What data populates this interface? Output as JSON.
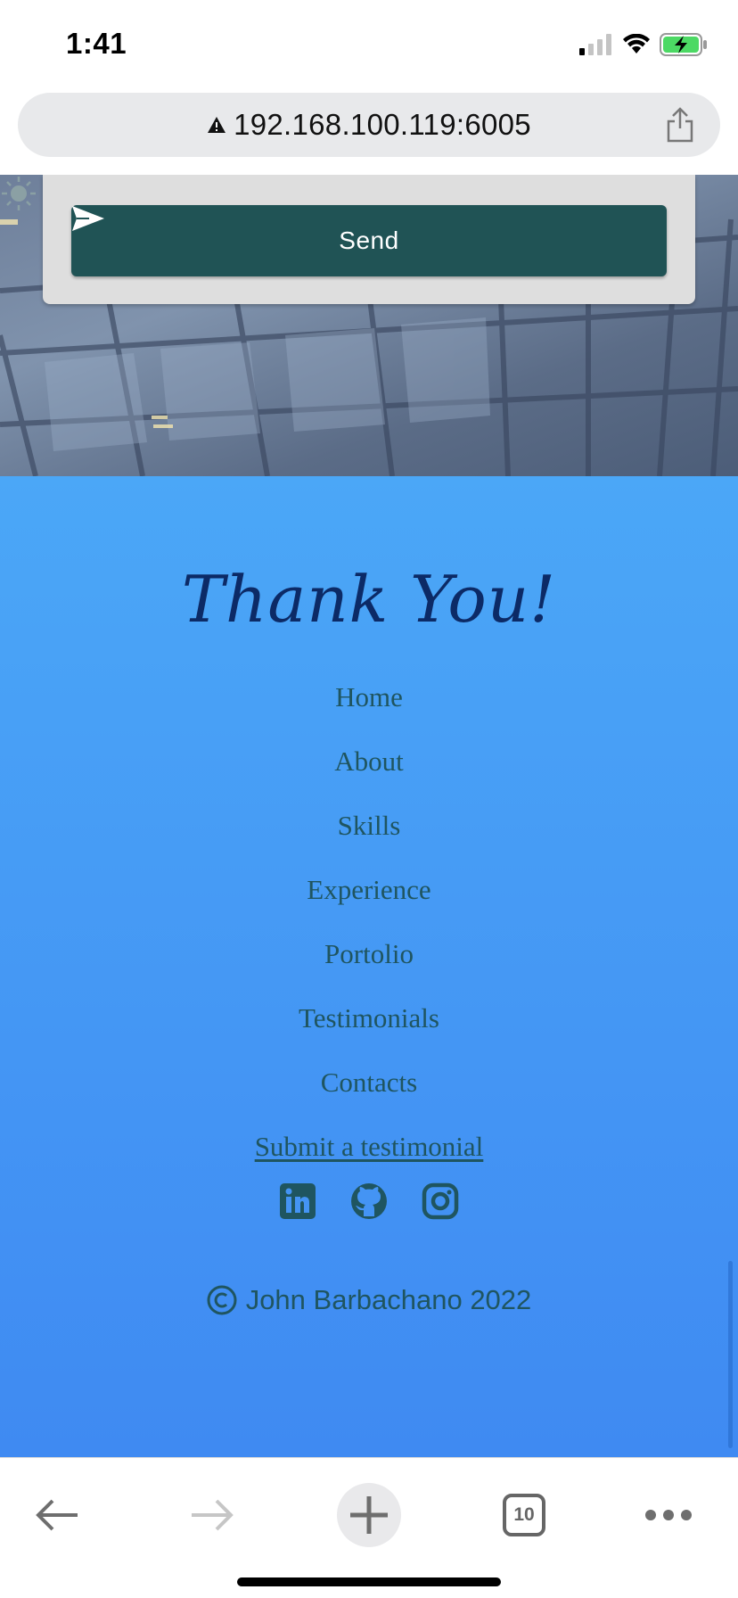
{
  "status_bar": {
    "time": "1:41",
    "signal_icon": "cellular-signal-icon",
    "wifi_icon": "wifi-icon",
    "battery_icon": "battery-charging-icon",
    "battery_color": "#4cd964"
  },
  "address_bar": {
    "warning_icon": "not-secure-warning-icon",
    "url": "192.168.100.119:6005",
    "share_icon": "share-icon"
  },
  "contact_form": {
    "send_label": "Send",
    "send_icon": "paper-plane-icon",
    "button_color": "#205355",
    "theme_toggle_icon": "sun-icon"
  },
  "footer": {
    "title": "Thank You!",
    "nav_links": [
      "Home",
      "About",
      "Skills",
      "Experience",
      "Portolio",
      "Testimonials",
      "Contacts"
    ],
    "submit_link": "Submit a testimonial",
    "social": [
      {
        "name": "linkedin",
        "icon": "linkedin-icon"
      },
      {
        "name": "github",
        "icon": "github-icon"
      },
      {
        "name": "instagram",
        "icon": "instagram-icon"
      }
    ],
    "copyright_icon": "copyright-icon",
    "copyright_text": "John Barbachano 2022",
    "gradient_top": "#4ba7f7",
    "gradient_bottom": "#3f8af2",
    "text_color": "#1f5560",
    "title_color": "#0c2a66"
  },
  "toolbar": {
    "back_icon": "back-arrow-icon",
    "forward_icon": "forward-arrow-icon",
    "new_tab_icon": "plus-icon",
    "tabs_count": "10",
    "tabs_icon": "tabs-icon",
    "menu_icon": "more-dots-icon"
  }
}
